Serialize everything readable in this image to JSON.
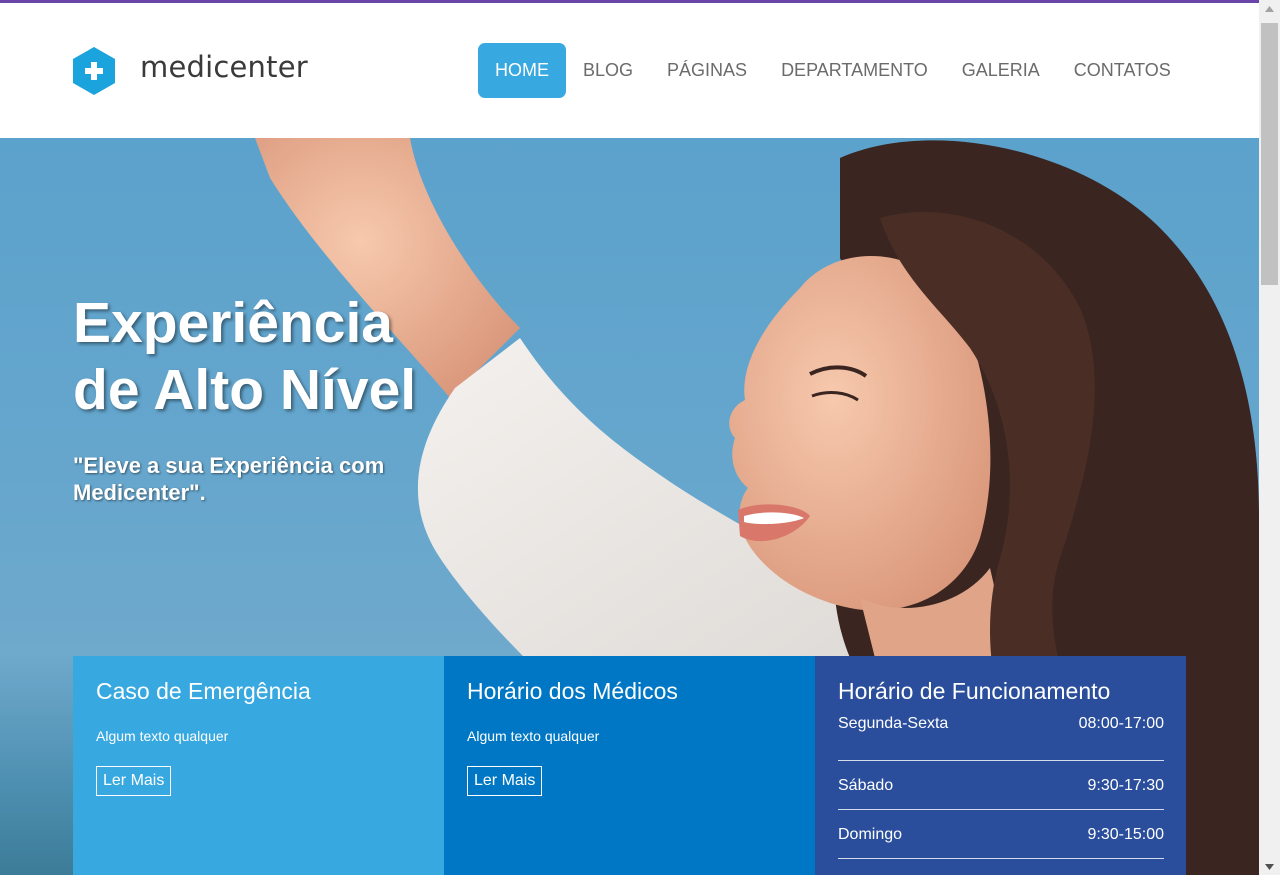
{
  "brand": {
    "name": "medicenter",
    "color": "#1aa3dc"
  },
  "nav": {
    "items": [
      {
        "label": "HOME",
        "active": true
      },
      {
        "label": "BLOG",
        "active": false
      },
      {
        "label": "PÁGINAS",
        "active": false
      },
      {
        "label": "DEPARTAMENTO",
        "active": false
      },
      {
        "label": "GALERIA",
        "active": false
      },
      {
        "label": "CONTATOS",
        "active": false
      }
    ]
  },
  "hero": {
    "title_line1": "Experiência",
    "title_line2": "de Alto Nível",
    "subtitle": "\"Eleve a sua Experiência com Medicenter\"."
  },
  "boxes": [
    {
      "title": "Caso de Emergência",
      "text": "Algum texto qualquer",
      "button": "Ler Mais",
      "color": "#37a8e0"
    },
    {
      "title": "Horário dos Médicos",
      "text": "Algum texto qualquer",
      "button": "Ler Mais",
      "color": "#0077c4"
    },
    {
      "title": "Horário de Funcionamento",
      "color": "#2a4e9b",
      "hours": [
        {
          "day": "Segunda-Sexta",
          "time": "08:00-17:00"
        },
        {
          "day": "Sábado",
          "time": "9:30-17:30"
        },
        {
          "day": "Domingo",
          "time": "9:30-15:00"
        }
      ]
    }
  ],
  "colors": {
    "accent": "#37a8e0",
    "top_border": "#6a45a8"
  }
}
